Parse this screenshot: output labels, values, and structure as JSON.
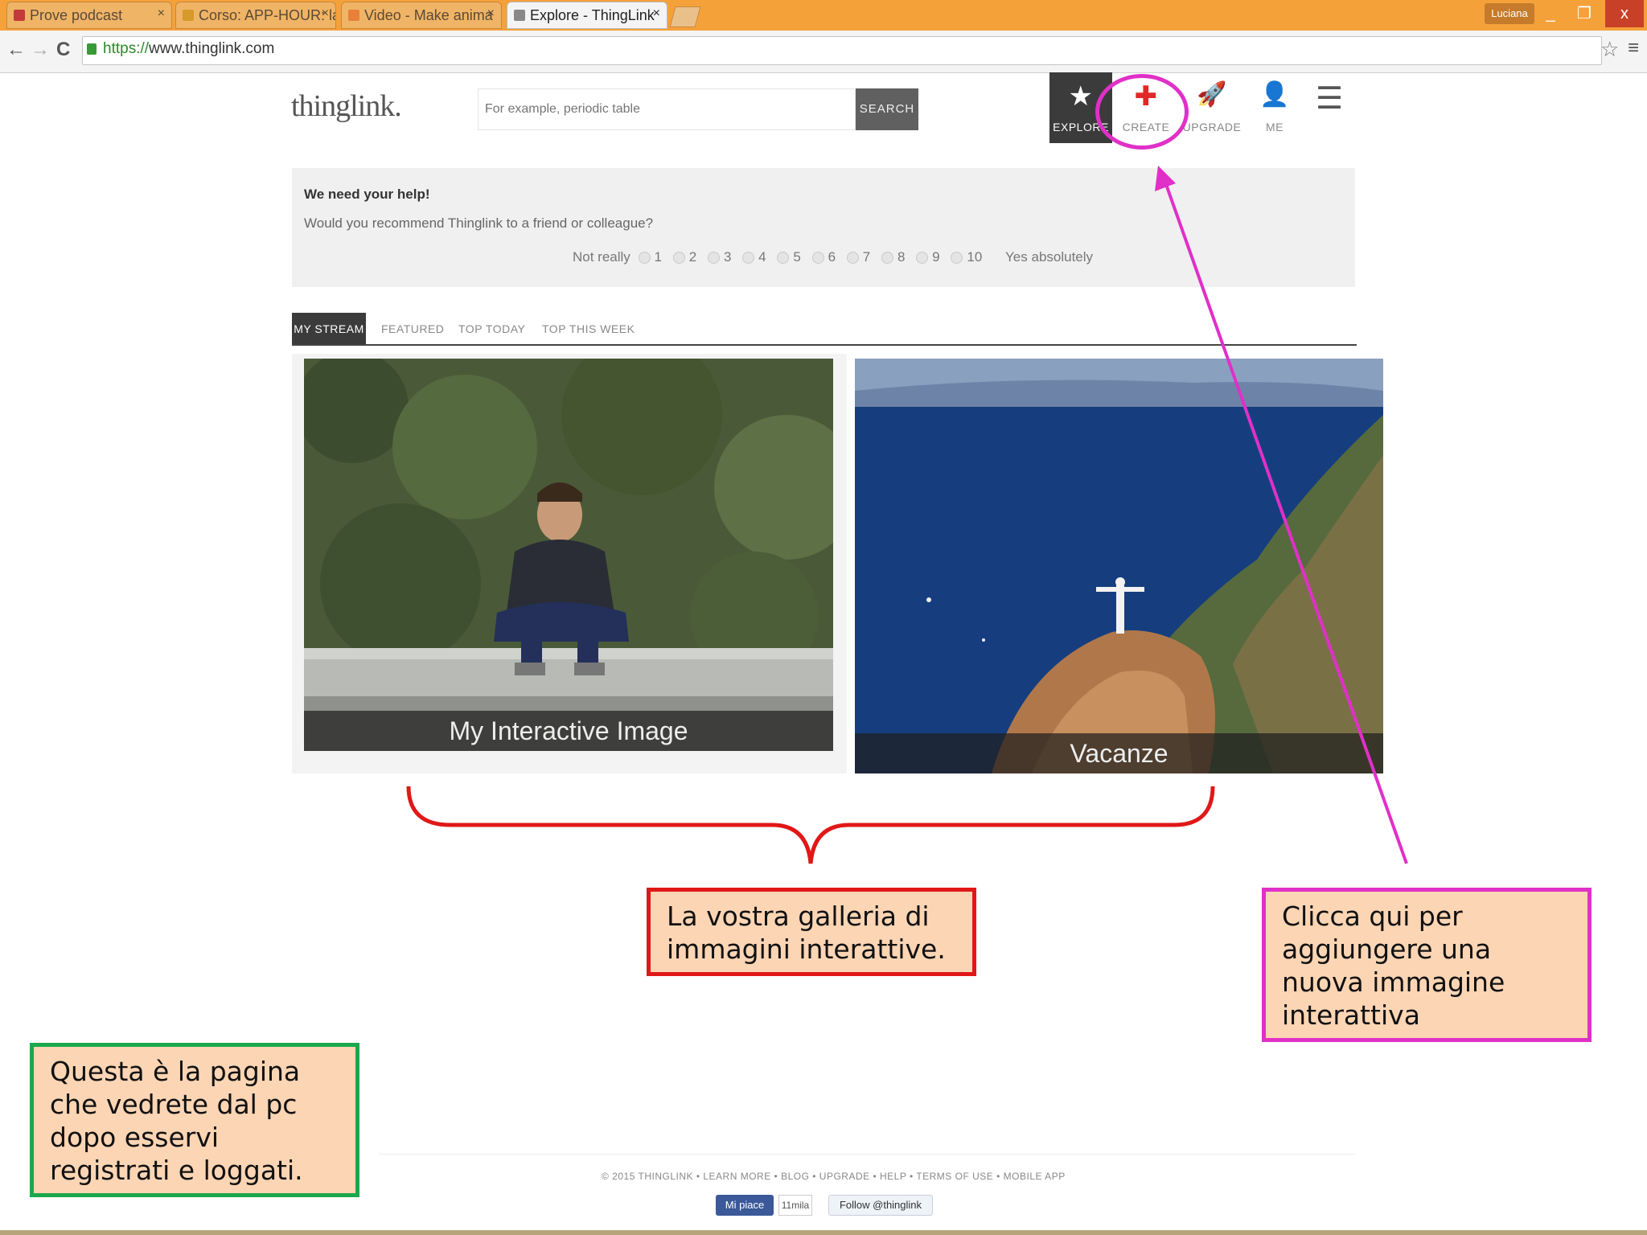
{
  "browser": {
    "tabs": [
      {
        "label": "Prove podcast",
        "close": "×"
      },
      {
        "label": "Corso: APP-HOUR: la",
        "close": "×"
      },
      {
        "label": "Video - Make anima",
        "close": "×"
      },
      {
        "label": "Explore - ThingLink",
        "close": "×"
      }
    ],
    "user": "Luciana",
    "window_controls": {
      "minimize": "_",
      "maximize": "❐",
      "close": "x"
    },
    "url_scheme": "https://",
    "url_host": "www.thinglink.com",
    "nav": {
      "back": "←",
      "forward": "→",
      "reload": "C",
      "star": "☆",
      "menu": "≡"
    }
  },
  "site": {
    "logo": "thinglink.",
    "search": {
      "placeholder": "For example, periodic table",
      "button": "SEARCH"
    },
    "nav": {
      "explore": {
        "label": "EXPLORE",
        "icon": "★"
      },
      "create": {
        "label": "CREATE",
        "icon": "✚"
      },
      "upgrade": {
        "label": "UPGRADE",
        "icon": "🚀"
      },
      "me": {
        "label": "ME",
        "icon": "👤"
      },
      "menu_icon": "☰"
    },
    "survey": {
      "title": "We need your help!",
      "question": "Would you recommend Thinglink to a friend or colleague?",
      "low": "Not really",
      "high": "Yes absolutely",
      "scale": [
        "1",
        "2",
        "3",
        "4",
        "5",
        "6",
        "7",
        "8",
        "9",
        "10"
      ]
    },
    "tabs": [
      "MY STREAM",
      "FEATURED",
      "TOP TODAY",
      "TOP THIS WEEK"
    ],
    "cards": [
      {
        "caption": "My Interactive Image"
      },
      {
        "caption": "Vacanze"
      }
    ],
    "footer": {
      "links": "© 2015 THINGLINK • LEARN MORE • BLOG • UPGRADE • HELP • TERMS OF USE • MOBILE APP",
      "fb_like": "Mi piace",
      "fb_count": "11mila",
      "twitter": "Follow @thinglink"
    }
  },
  "annotations": {
    "gallery": "La vostra galleria di immagini interattive.",
    "create": "Clicca qui per aggiungere una nuova immagine interattiva",
    "page": "Questa è la pagina che vedrete dal pc dopo esservi registrati e loggati.",
    "colors": {
      "gallery_border": "#e01818",
      "create_border": "#e030c8",
      "page_border": "#1aa84a",
      "fill": "#fcd5b4"
    }
  }
}
